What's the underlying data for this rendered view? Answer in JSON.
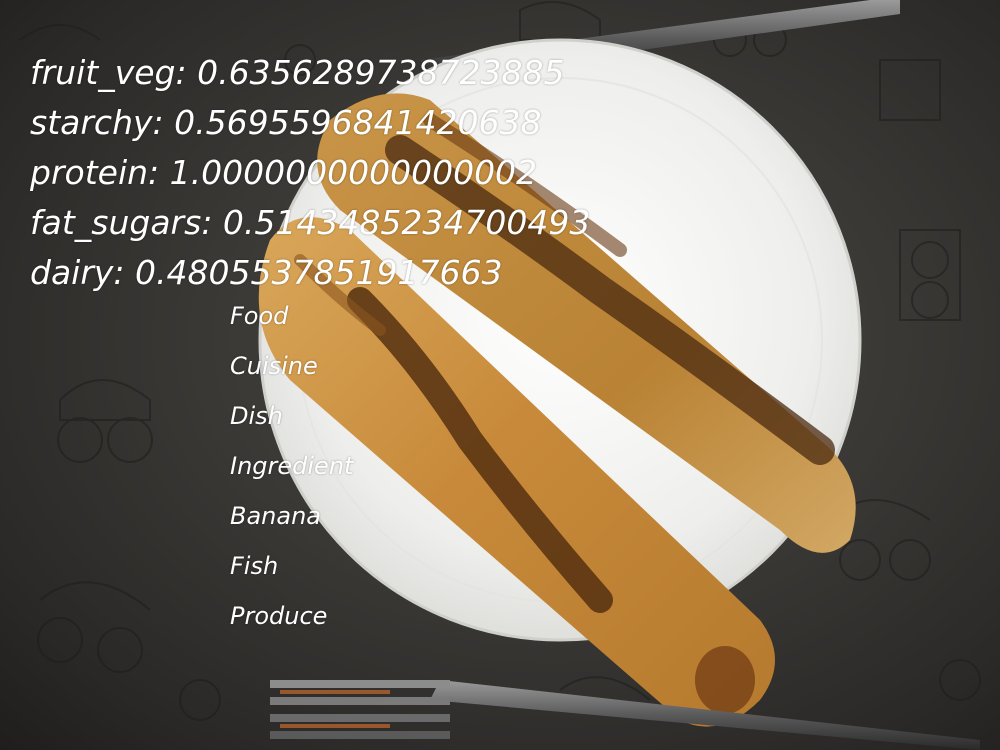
{
  "scores": [
    {
      "key": "fruit_veg",
      "value": "0.6356289738723885",
      "text": "fruit_veg: 0.6356289738723885"
    },
    {
      "key": "starchy",
      "value": "0.5695596841420638",
      "text": "starchy: 0.5695596841420638"
    },
    {
      "key": "protein",
      "value": "1.0000000000000002",
      "text": "protein: 1.0000000000000002"
    },
    {
      "key": "fat_sugars",
      "value": "0.5143485234700493",
      "text": "fat_sugars: 0.5143485234700493"
    },
    {
      "key": "dairy",
      "value": "0.4805537851917663",
      "text": "dairy: 0.4805537851917663"
    }
  ],
  "labels": [
    "Food",
    "Cuisine",
    "Dish",
    "Ingredient",
    "Banana",
    "Fish",
    "Produce"
  ],
  "colors": {
    "overlay_text": "#ffffff",
    "plate": "#f4f4f2",
    "table": "#3a3835",
    "crepe": "#c98f3e",
    "crepe_dark": "#5a3212"
  }
}
